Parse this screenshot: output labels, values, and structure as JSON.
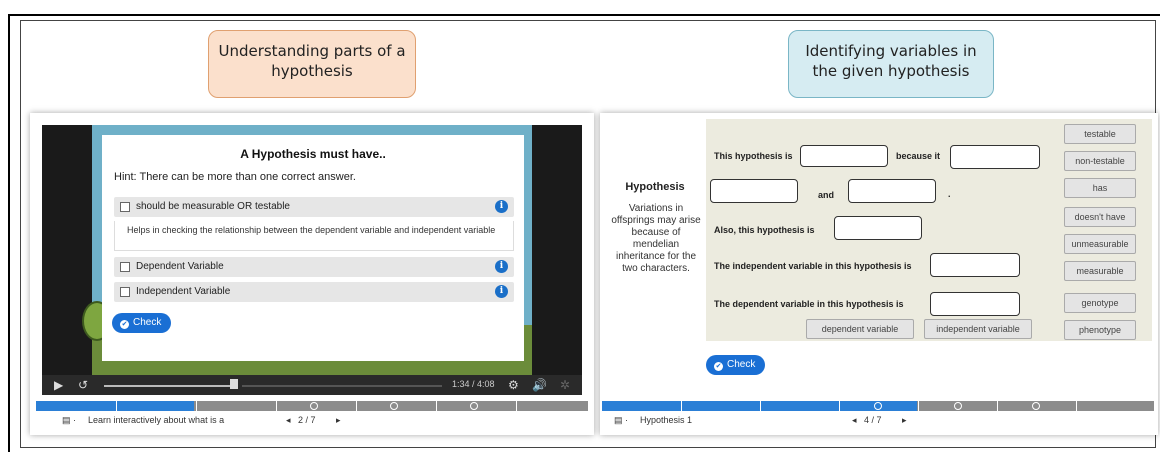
{
  "callouts": {
    "left": "Understanding parts of a hypothesis",
    "right": "Identifying variables in the given hypothesis"
  },
  "left_panel": {
    "modal_title": "A Hypothesis must have..",
    "hint": "Hint: There can be more than one correct answer.",
    "options": [
      {
        "label": "should be measurable OR testable",
        "info": "i"
      },
      {
        "label": "Dependent Variable",
        "info": "i"
      },
      {
        "label": "Independent Variable",
        "info": "i"
      }
    ],
    "option_detail": "Helps in checking the relationship between the dependent variable and independent variable",
    "check_label": "Check",
    "time": "1:34 / 4:08",
    "footer_title": "Learn interactively about what is a",
    "page": "2 / 7",
    "progress": 0.2857
  },
  "right_panel": {
    "hypothesis_heading": "Hypothesis",
    "hypothesis_text": "Variations in offsprings may arise because of mendelian inheritance for the two characters.",
    "sentences": {
      "s1a": "This hypothesis is",
      "s1b": "because it",
      "s2": "and",
      "s2end": ".",
      "s3": "Also, this hypothesis is",
      "s4": "The independent variable in this hypothesis is",
      "s5": "The dependent variable in this hypothesis is"
    },
    "chips": [
      "testable",
      "non-testable",
      "has",
      "doesn't have",
      "unmeasurable",
      "measurable",
      "genotype",
      "phenotype"
    ],
    "bottom_chips": [
      "dependent variable",
      "independent variable"
    ],
    "check_label": "Check",
    "footer_title": "Hypothesis 1",
    "page": "4 / 7",
    "progress": 0.5714
  },
  "colors": {
    "accent_blue": "#1a6fd4",
    "callout_orange": "#fbe0cc",
    "callout_blue": "#d6ecf2",
    "work_bg": "#ecebdf"
  }
}
